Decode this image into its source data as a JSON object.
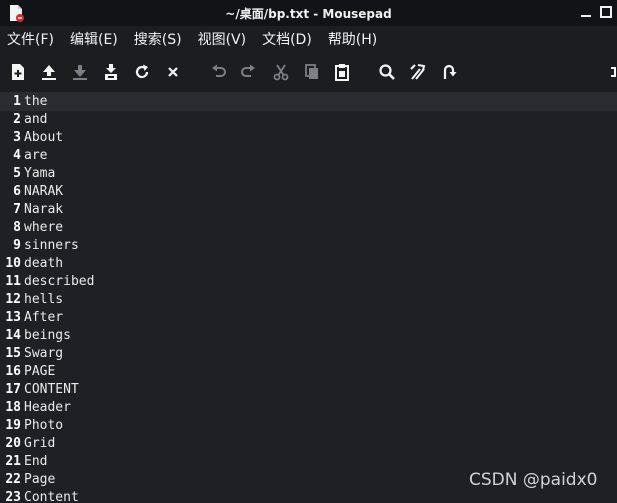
{
  "window": {
    "title": "~/桌面/bp.txt - Mousepad",
    "icons": {
      "app": "document-icon",
      "minimize": "minimize-icon",
      "maximize": "maximize-icon"
    }
  },
  "menu": [
    "文件(F)",
    "编辑(E)",
    "搜索(S)",
    "视图(V)",
    "文档(D)",
    "帮助(H)"
  ],
  "toolbar": [
    "new-document-icon",
    "open-icon",
    "save-icon",
    "save-as-icon",
    "reload-icon",
    "close-icon",
    "undo-icon",
    "redo-icon",
    "cut-icon",
    "copy-icon",
    "paste-icon",
    "search-icon",
    "replace-icon",
    "goto-icon",
    "fullscreen-icon"
  ],
  "editor": {
    "current_line": 1,
    "lines": [
      {
        "n": "1",
        "t": "the"
      },
      {
        "n": "2",
        "t": "and"
      },
      {
        "n": "3",
        "t": "About"
      },
      {
        "n": "4",
        "t": "are"
      },
      {
        "n": "5",
        "t": "Yama"
      },
      {
        "n": "6",
        "t": "NARAK"
      },
      {
        "n": "7",
        "t": "Narak"
      },
      {
        "n": "8",
        "t": "where"
      },
      {
        "n": "9",
        "t": "sinners"
      },
      {
        "n": "10",
        "t": "death"
      },
      {
        "n": "11",
        "t": "described"
      },
      {
        "n": "12",
        "t": "hells"
      },
      {
        "n": "13",
        "t": "After"
      },
      {
        "n": "14",
        "t": "beings"
      },
      {
        "n": "15",
        "t": "Swarg"
      },
      {
        "n": "16",
        "t": "PAGE"
      },
      {
        "n": "17",
        "t": "CONTENT"
      },
      {
        "n": "18",
        "t": "Header"
      },
      {
        "n": "19",
        "t": "Photo"
      },
      {
        "n": "20",
        "t": "Grid"
      },
      {
        "n": "21",
        "t": "End"
      },
      {
        "n": "22",
        "t": "Page"
      },
      {
        "n": "23",
        "t": "Content"
      }
    ]
  },
  "watermark": "CSDN @paidx0",
  "colors": {
    "titlebar": "#121316",
    "background": "#1e2025",
    "text": "#eaeaea",
    "current_line": "#2a2c31"
  }
}
